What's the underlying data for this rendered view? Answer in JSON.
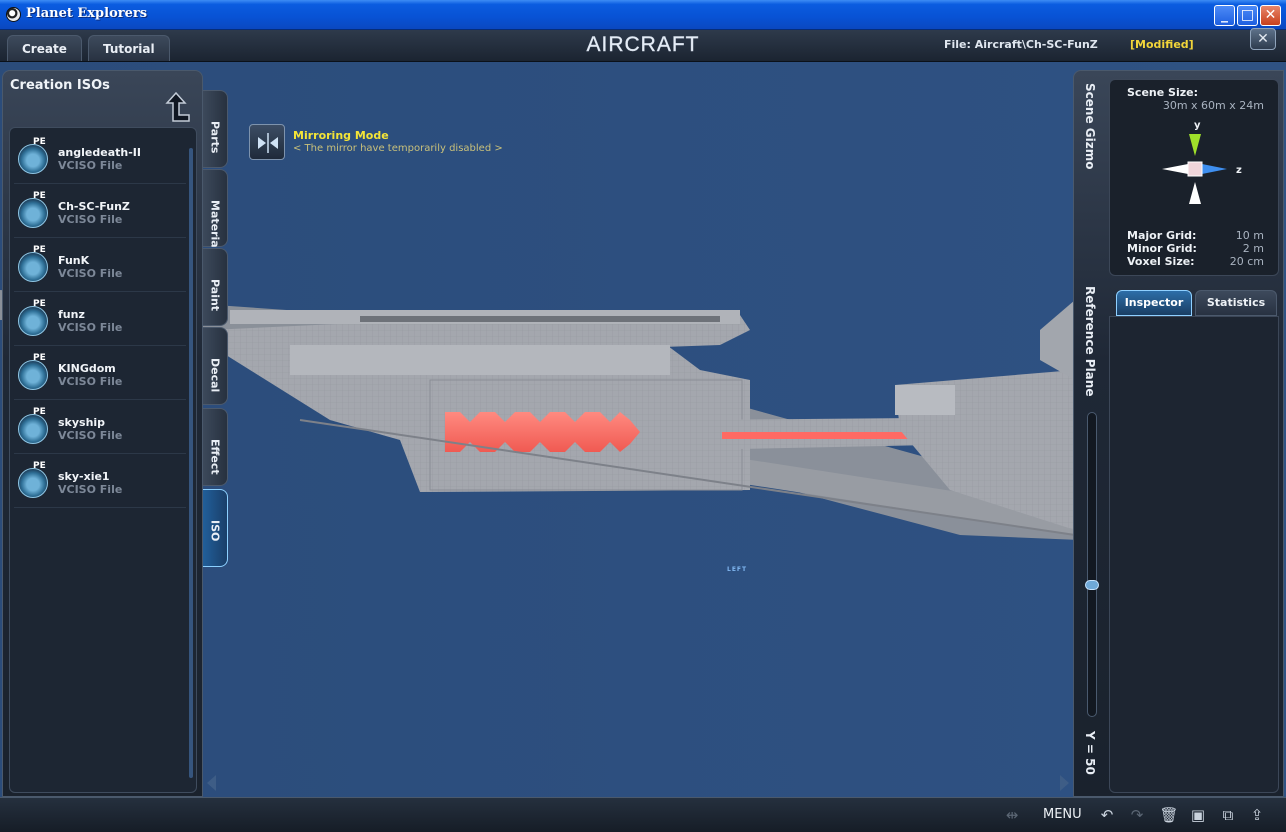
{
  "window": {
    "title": "Planet Explorers",
    "controls": {
      "minimize": "_",
      "maximize": "□",
      "close": "✕"
    }
  },
  "topbar": {
    "tabs": [
      {
        "label": "Create"
      },
      {
        "label": "Tutorial"
      }
    ],
    "brand": "AIRCRAFT",
    "file_info": "File: Aircraft\\Ch-SC-FunZ",
    "modified": "[Modified]",
    "close_glyph": "✕"
  },
  "left_panel": {
    "title": "Creation ISOs",
    "items": [
      {
        "name": "angledeath-II",
        "type": "VCISO File",
        "badge": "PE"
      },
      {
        "name": "Ch-SC-FunZ",
        "type": "VCISO File",
        "badge": "PE"
      },
      {
        "name": "FunK",
        "type": "VCISO File",
        "badge": "PE"
      },
      {
        "name": "funz",
        "type": "VCISO File",
        "badge": "PE"
      },
      {
        "name": "KINGdom",
        "type": "VCISO File",
        "badge": "PE"
      },
      {
        "name": "skyship",
        "type": "VCISO File",
        "badge": "PE"
      },
      {
        "name": "sky-xie1",
        "type": "VCISO File",
        "badge": "PE"
      }
    ]
  },
  "vertical_tabs": [
    {
      "label": "Parts"
    },
    {
      "label": "Material"
    },
    {
      "label": "Paint"
    },
    {
      "label": "Decal"
    },
    {
      "label": "Effect"
    },
    {
      "label": "ISO",
      "active": true
    }
  ],
  "mirror": {
    "title": "Mirroring Mode",
    "subtitle": "< The mirror have temporarily disabled >"
  },
  "viewport": {
    "view_label": "LEFT"
  },
  "scene_gizmo": {
    "side_label": "Scene Gizmo",
    "scene_size_label": "Scene Size:",
    "scene_size_value": "30m x 60m x 24m",
    "axis_y": "y",
    "axis_z": "z",
    "major_grid_label": "Major Grid:",
    "major_grid_value": "10 m",
    "minor_grid_label": "Minor Grid:",
    "minor_grid_value": "2 m",
    "voxel_size_label": "Voxel Size:",
    "voxel_size_value": "20 cm"
  },
  "inspector": {
    "tab_inspector": "Inspector",
    "tab_statistics": "Statistics"
  },
  "reference_plane": {
    "side_label": "Reference Plane",
    "y_label": "Y = 50",
    "level": 0.57
  },
  "bottombar": {
    "menu_label": "MENU",
    "icons": [
      "mirror-icon",
      "undo-icon",
      "redo-icon",
      "delete-icon",
      "save-icon",
      "save-as-icon",
      "export-icon"
    ]
  },
  "colors": {
    "title_bar": "#0852d4",
    "accent_yellow": "#f4e437",
    "modified": "#f2d53a",
    "glow_red": "#ff6a63",
    "active_tab": "#8cd0ff"
  }
}
